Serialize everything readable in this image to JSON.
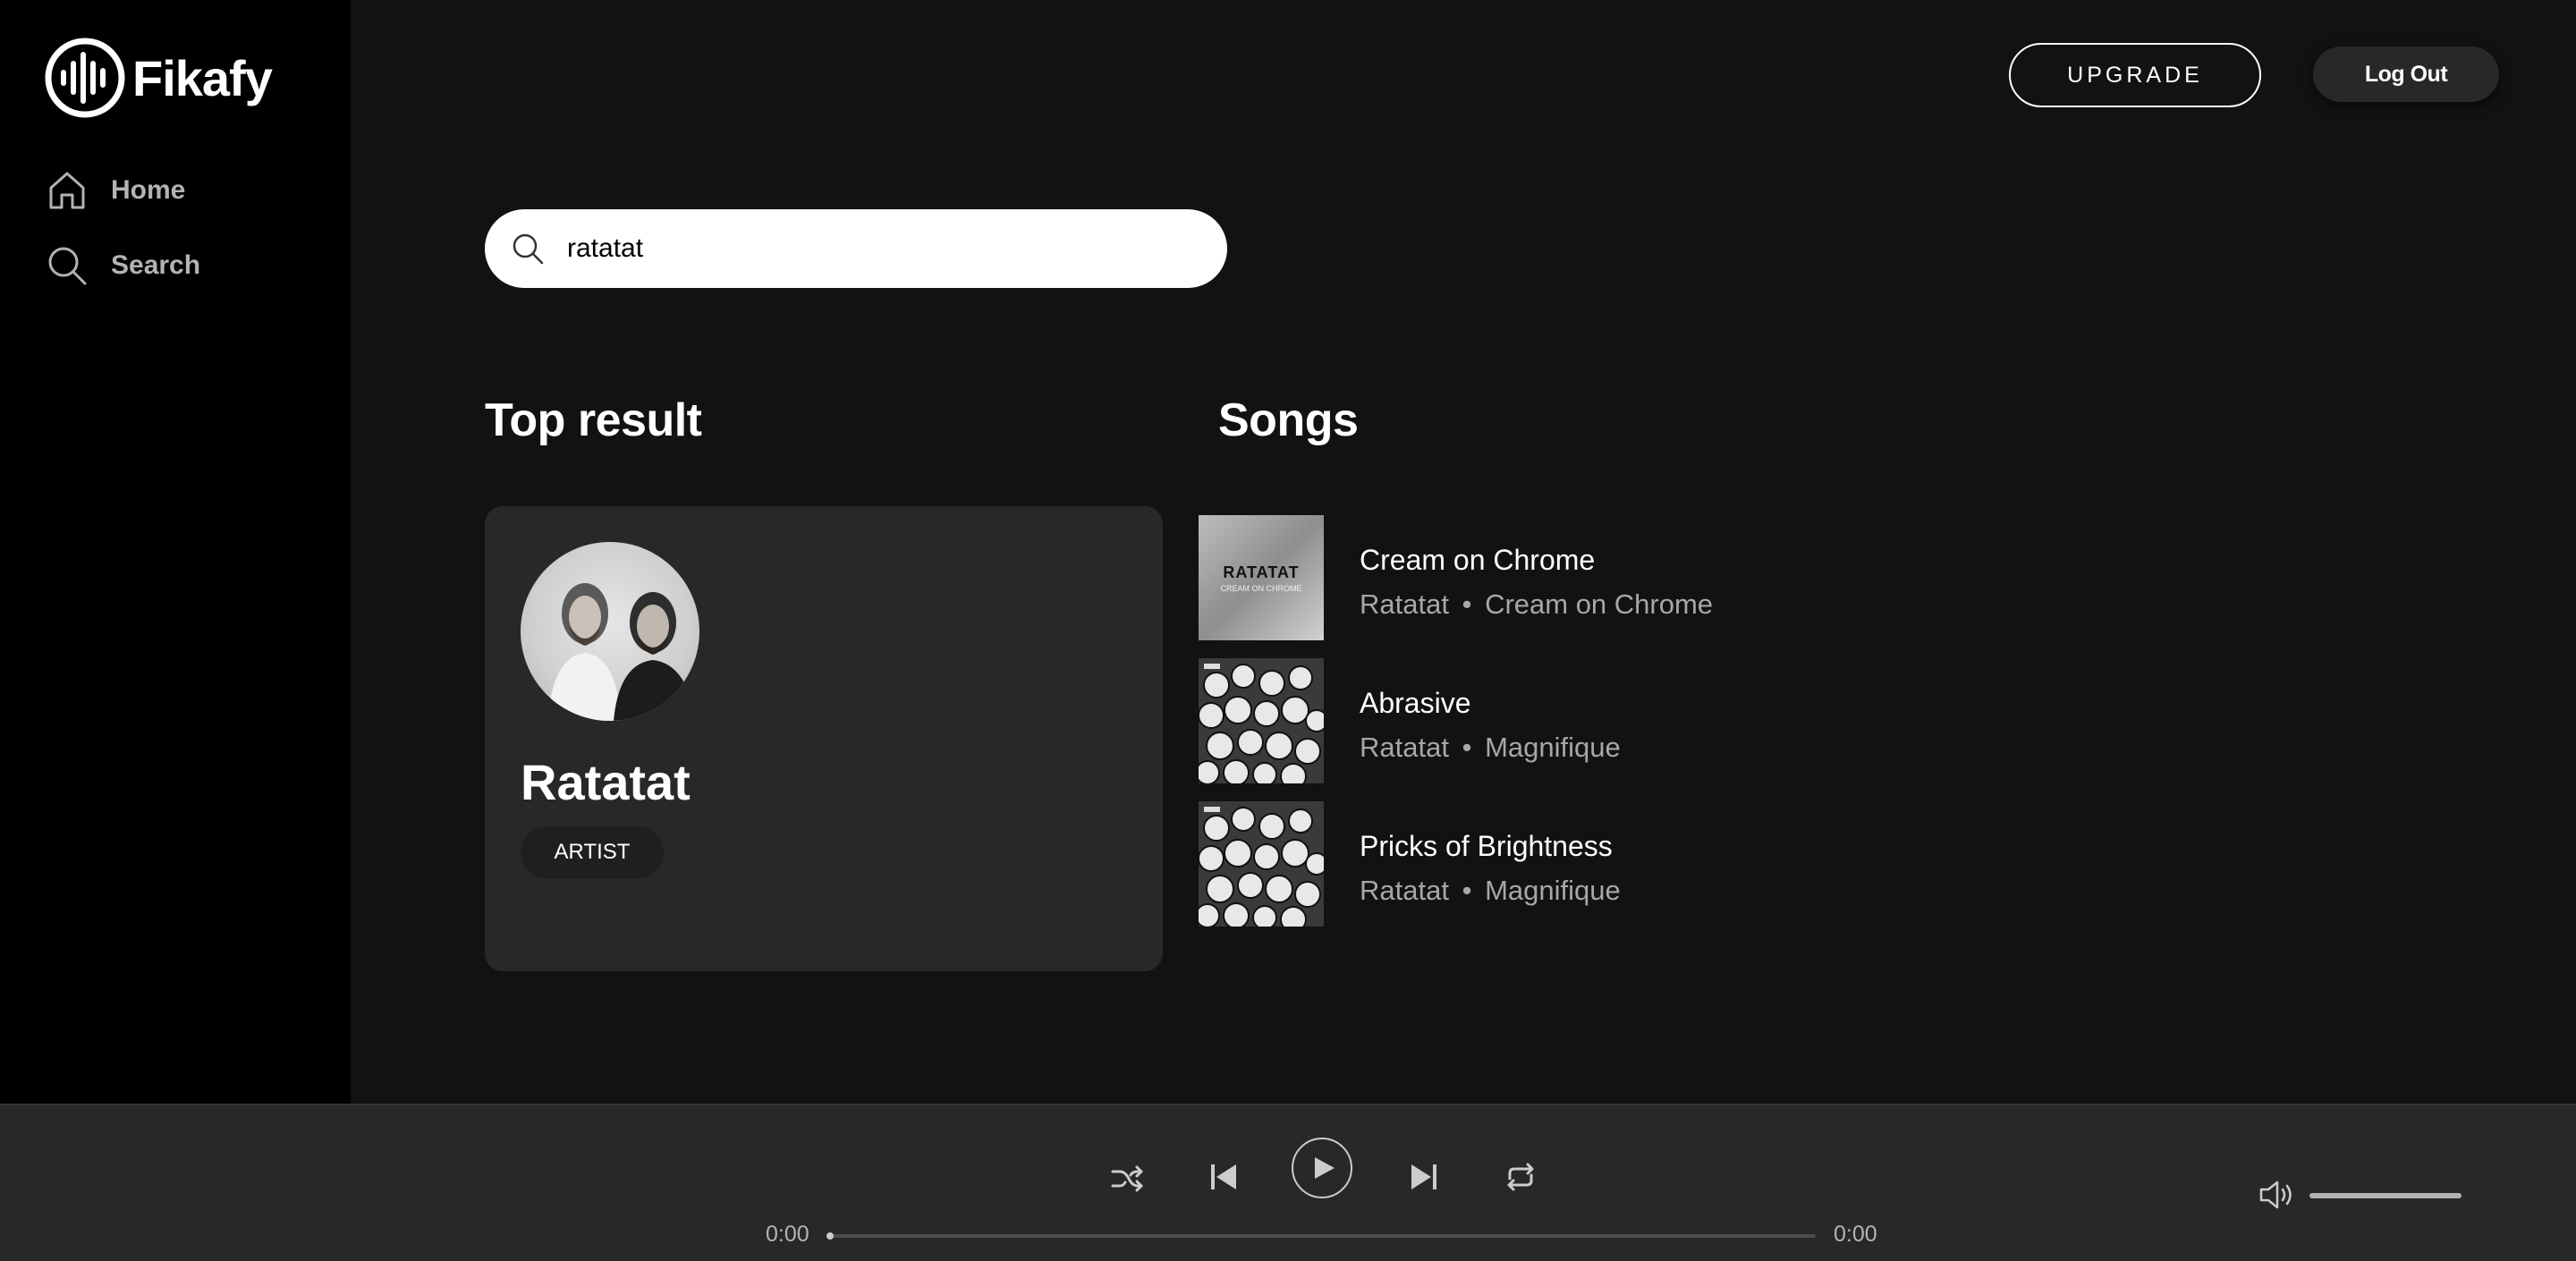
{
  "app": {
    "name": "Fikafy"
  },
  "sidebar": {
    "items": [
      {
        "label": "Home",
        "icon": "home-icon"
      },
      {
        "label": "Search",
        "icon": "search-icon"
      }
    ]
  },
  "header": {
    "upgrade_label": "UPGRADE",
    "logout_label": "Log Out"
  },
  "search": {
    "value": "ratatat"
  },
  "top_result": {
    "heading": "Top result",
    "name": "Ratatat",
    "type_badge": "ARTIST"
  },
  "songs": {
    "heading": "Songs",
    "items": [
      {
        "title": "Cream on Chrome",
        "artist": "Ratatat",
        "separator": "•",
        "album": "Cream on Chrome",
        "art_title": "RATATAT",
        "art_subtitle": "CREAM ON CHROME"
      },
      {
        "title": "Abrasive",
        "artist": "Ratatat",
        "separator": "•",
        "album": "Magnifique"
      },
      {
        "title": "Pricks of Brightness",
        "artist": "Ratatat",
        "separator": "•",
        "album": "Magnifique"
      }
    ]
  },
  "player": {
    "current_time": "0:00",
    "total_time": "0:00",
    "progress": 0,
    "volume": 1.0,
    "controls": [
      "shuffle-icon",
      "previous-icon",
      "play-icon",
      "next-icon",
      "repeat-icon"
    ]
  }
}
